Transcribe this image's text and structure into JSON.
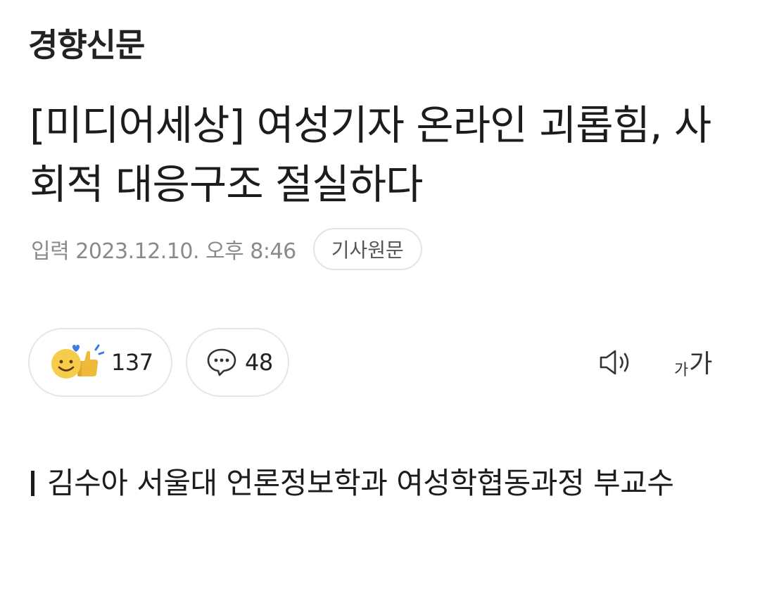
{
  "brand": {
    "name": "경향신문"
  },
  "article": {
    "title": "[미디어세상] 여성기자 온라인 괴롭힘, 사회적 대응구조 절실하다",
    "date": "입력 2023.12.10. 오후 8:46",
    "origin_button": "기사원문",
    "subtitle": "김수아 서울대 언론정보학과 여성학협동과정 부교수"
  },
  "actions": {
    "reaction_count": "137",
    "comment_count": "48",
    "font_small": "가",
    "font_big": "가"
  },
  "icons": {
    "reaction": "smile-thumbsup-icon",
    "comment": "speech-bubble-icon",
    "speaker": "speaker-icon",
    "font_size": "font-size-icon"
  },
  "colors": {
    "reaction_face": "#f7cc4a",
    "reaction_heart": "#3b7de0"
  }
}
